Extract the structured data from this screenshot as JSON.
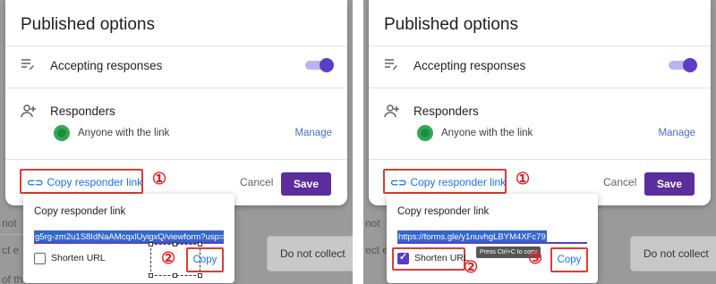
{
  "panels": [
    {
      "title": "Published options",
      "accepting_label": "Accepting responses",
      "responders_label": "Responders",
      "audience": "Anyone with the link",
      "manage": "Manage",
      "copy_link_label": "Copy responder link",
      "cancel": "Cancel",
      "save": "Save",
      "callout_1": "①",
      "popup": {
        "title": "Copy responder link",
        "url": "g5rg-zm2u1S8IdNaAMcqxlUyigxQ/viewform?usp=dialog",
        "shorten_label": "Shorten URL",
        "shorten_checked": false,
        "copy": "Copy",
        "callout_2": "②"
      },
      "background": {
        "frag1": "ct e",
        "frag2": "not",
        "frag3": "of th",
        "select": "Do not collect"
      }
    },
    {
      "title": "Published options",
      "accepting_label": "Accepting responses",
      "responders_label": "Responders",
      "audience": "Anyone with the link",
      "manage": "Manage",
      "copy_link_label": "Copy responder link",
      "cancel": "Cancel",
      "save": "Save",
      "callout_1": "①",
      "popup": {
        "title": "Copy responder link",
        "url": "https://forms.gle/y1nuvhgLBYM4XFc79",
        "shorten_label": "Shorten URL",
        "shorten_checked": true,
        "copy": "Copy",
        "tooltip": "Press Ctrl+C to copy",
        "callout_2": "②",
        "callout_3": "③"
      },
      "background": {
        "frag1": "ect e",
        "frag2": "not",
        "select": "Do not collect"
      }
    }
  ],
  "colors": {
    "accent": "#5b3dc8",
    "save_bg": "#5b2d9e",
    "link": "#1a73e8",
    "highlight": "#e03c31"
  }
}
